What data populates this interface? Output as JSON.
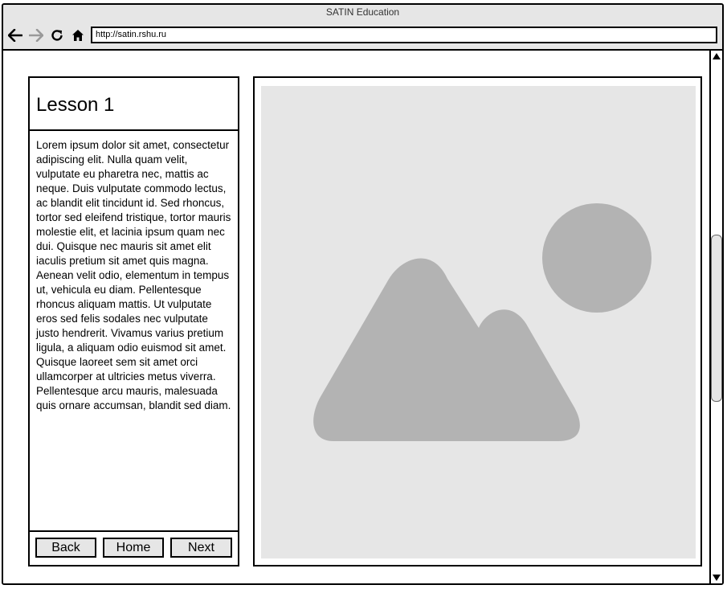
{
  "window": {
    "title": "SATIN Education",
    "address": "http://satin.rshu.ru"
  },
  "nav": {
    "back_icon": "arrow-left-icon",
    "forward_icon": "arrow-right-icon",
    "reload_icon": "reload-icon",
    "home_icon": "home-icon"
  },
  "lesson": {
    "title": "Lesson 1",
    "body": "Lorem ipsum dolor sit amet, consectetur adipiscing elit. Nulla quam velit, vulputate eu pharetra nec, mattis ac neque. Duis vulputate commodo lectus, ac blandit elit tincidunt id. Sed rhoncus, tortor sed eleifend tristique, tortor mauris molestie elit, et lacinia ipsum quam nec dui. Quisque nec mauris sit amet elit iaculis pretium sit amet quis magna. Aenean velit odio, elementum in tempus ut, vehicula eu diam. Pellentesque rhoncus aliquam mattis. Ut vulputate eros sed felis sodales nec vulputate justo hendrerit. Vivamus varius pretium ligula, a aliquam odio euismod sit amet. Quisque laoreet sem sit amet orci ullamcorper at ultricies metus viverra. Pellentesque arcu mauris, malesuada quis ornare accumsan, blandit sed diam."
  },
  "buttons": {
    "back": "Back",
    "home": "Home",
    "next": "Next"
  },
  "image": {
    "icon": "image-placeholder-icon"
  },
  "colors": {
    "chrome": "#e6e6e6",
    "placeholder_shape": "#b3b3b3",
    "disabled_icon": "#999999"
  }
}
